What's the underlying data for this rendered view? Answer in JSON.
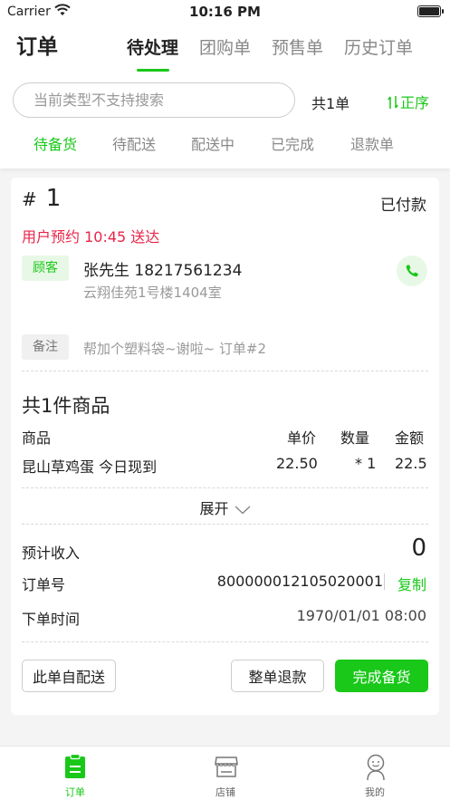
{
  "status_bar": {
    "carrier": "Carrier",
    "time": "10:16 PM"
  },
  "header": {
    "title": "订单",
    "tabs": [
      {
        "label": "待处理",
        "active": true
      },
      {
        "label": "团购单",
        "active": false
      },
      {
        "label": "预售单",
        "active": false
      },
      {
        "label": "历史订单",
        "active": false
      }
    ],
    "search_placeholder": "当前类型不支持搜索",
    "count": "共1单",
    "sort": "正序",
    "sub_tabs": [
      {
        "label": "待备货",
        "active": true
      },
      {
        "label": "待配送",
        "active": false
      },
      {
        "label": "配送中",
        "active": false
      },
      {
        "label": "已完成",
        "active": false
      },
      {
        "label": "退款单",
        "active": false
      }
    ]
  },
  "order": {
    "hash": "#",
    "number": "1",
    "pay_status": "已付款",
    "eta": "用户预约 10:45 送达",
    "customer_tag": "顾客",
    "customer_name": "张先生  18217561234",
    "customer_address": "云翔佳苑1号楼1404室",
    "note_tag": "备注",
    "note": "帮加个塑料袋~谢啦~ 订单#2",
    "goods_title": "共1件商品",
    "goods_headers": {
      "name": "商品",
      "price": "单价",
      "qty": "数量",
      "amount": "金额"
    },
    "goods": [
      {
        "name": "昆山草鸡蛋 今日现到",
        "price": "22.50",
        "qty": "* 1",
        "amount": "22.5"
      }
    ],
    "expand_label": "展开",
    "income_label": "预计收入",
    "income": "0",
    "order_no_label": "订单号",
    "order_no": "800000012105020001",
    "copy_label": "复制",
    "time_label": "下单时间",
    "order_time": "1970/01/01 08:00",
    "buttons": {
      "self_delivery": "此单自配送",
      "refund": "整单退款",
      "complete": "完成备货"
    }
  },
  "tab_bar": [
    {
      "label": "订单",
      "icon": "clipboard-icon",
      "active": true
    },
    {
      "label": "店铺",
      "icon": "store-icon",
      "active": false
    },
    {
      "label": "我的",
      "icon": "user-icon",
      "active": false
    }
  ],
  "colors": {
    "accent": "#19c819",
    "alert": "#e8254a",
    "muted": "#999999"
  }
}
